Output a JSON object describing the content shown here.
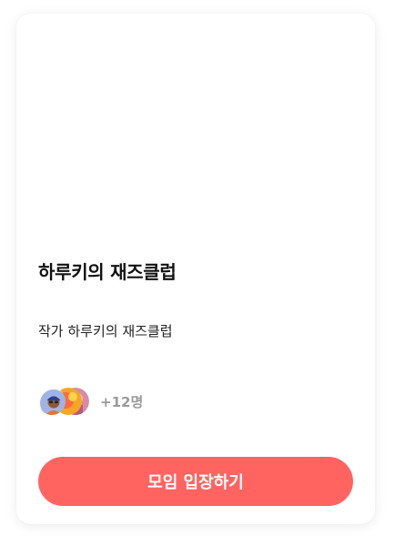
{
  "card": {
    "title": "하루키의 재즈클럽",
    "description": "작가 하루키의 재즈클럽",
    "members": {
      "extra_count": "+12명",
      "avatars": [
        "avatar-person-icon",
        "avatar-orange-icon",
        "avatar-pink-icon"
      ]
    },
    "join_button_label": "모임 입장하기"
  },
  "colors": {
    "accent": "#ff6461",
    "muted_text": "#9a9a9a"
  }
}
